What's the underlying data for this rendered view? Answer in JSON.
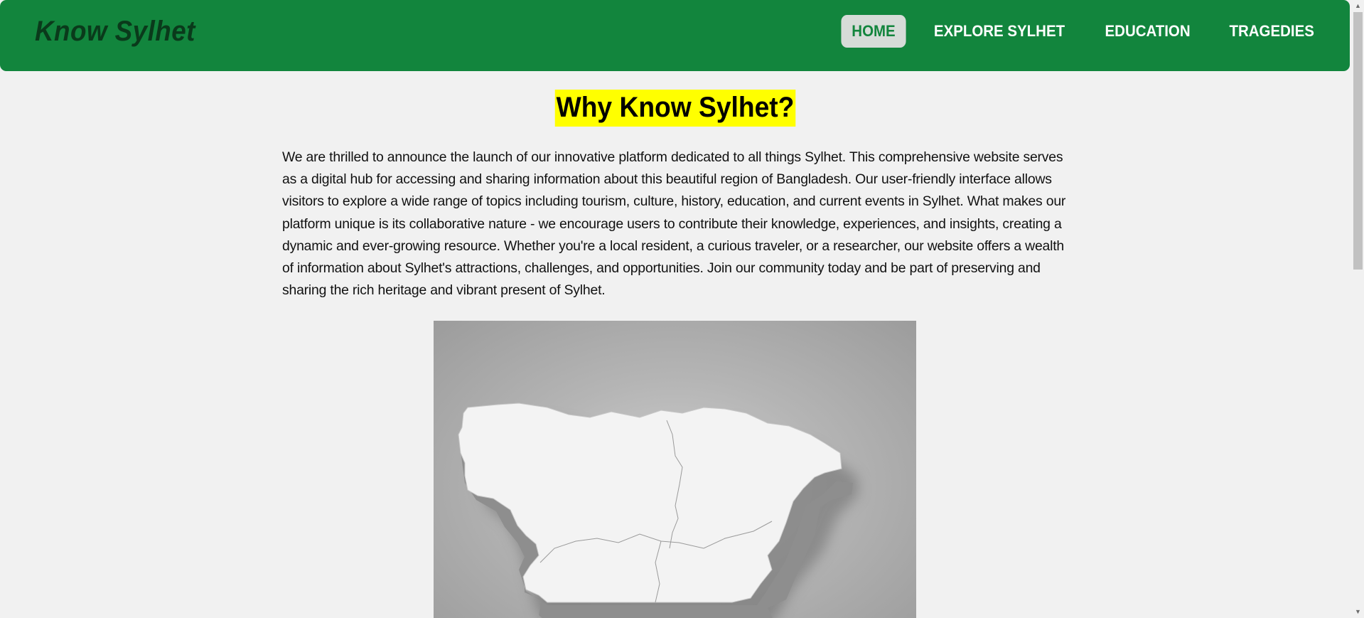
{
  "brand": {
    "title": "Know Sylhet"
  },
  "nav": {
    "items": [
      {
        "label": "HOME",
        "active": true
      },
      {
        "label": "EXPLORE SYLHET",
        "active": false
      },
      {
        "label": "EDUCATION",
        "active": false
      },
      {
        "label": "TRAGEDIES",
        "active": false
      }
    ]
  },
  "main": {
    "heading": "Why Know Sylhet?",
    "intro": "We are thrilled to announce the launch of our innovative platform dedicated to all things Sylhet. This comprehensive website serves as a digital hub for accessing and sharing information about this beautiful region of Bangladesh. Our user-friendly interface allows visitors to explore a wide range of topics including tourism, culture, history, education, and current events in Sylhet. What makes our platform unique is its collaborative nature - we encourage users to contribute their knowledge, experiences, and insights, creating a dynamic and ever-growing resource. Whether you're a local resident, a curious traveler, or a researcher, our website offers a wealth of information about Sylhet's attractions, challenges, and opportunities. Join our community today and be part of preserving and sharing the rich heritage and vibrant present of Sylhet."
  },
  "colors": {
    "navbar": "#12853d",
    "brand": "#0a3a1b",
    "heading_highlight": "#ffff00",
    "page_background": "#f1f1f1",
    "active_nav_bg": "#d6dcd8"
  },
  "icons": {
    "scroll_up": "triangle-up-icon",
    "scroll_down": "triangle-down-icon"
  }
}
